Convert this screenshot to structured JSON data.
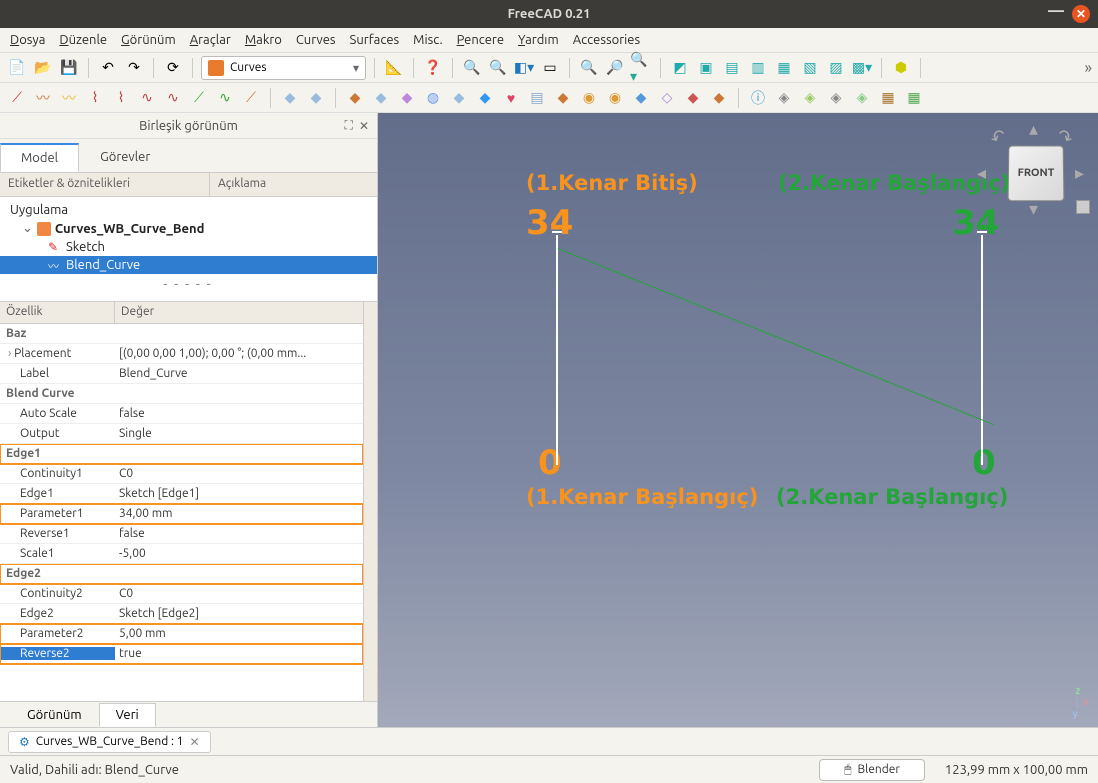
{
  "title": "FreeCAD 0.21",
  "menus": [
    "Dosya",
    "Düzenle",
    "Görünüm",
    "Araçlar",
    "Makro",
    "Curves",
    "Surfaces",
    "Misc.",
    "Pencere",
    "Yardım",
    "Accessories"
  ],
  "menu_underlines": [
    0,
    0,
    0,
    0,
    0,
    -1,
    -1,
    -1,
    0,
    0,
    -1
  ],
  "workbench": "Curves",
  "panel_title": "Birleşik görünüm",
  "tabs": {
    "model": "Model",
    "tasks": "Görevler"
  },
  "tree_headers": {
    "labels": "Etiketler & öznitelikleri",
    "desc": "Açıklama"
  },
  "tree": {
    "root": "Uygulama",
    "doc": "Curves_WB_Curve_Bend",
    "items": [
      "Sketch",
      "Blend_Curve"
    ],
    "selected": 1
  },
  "prop_headers": {
    "name": "Özellik",
    "value": "Değer"
  },
  "props": {
    "groups": [
      {
        "name": "Baz",
        "rows": [
          {
            "n": "Placement",
            "v": "[(0,00 0,00 1,00); 0,00 °; (0,00 mm...",
            "expand": true
          },
          {
            "n": "Label",
            "v": "Blend_Curve"
          }
        ]
      },
      {
        "name": "Blend Curve",
        "rows": [
          {
            "n": "Auto Scale",
            "v": "false"
          },
          {
            "n": "Output",
            "v": "Single"
          }
        ]
      },
      {
        "name": "Edge1",
        "hl": true,
        "rows": [
          {
            "n": "Continuity1",
            "v": "C0"
          },
          {
            "n": "Edge1",
            "v": "Sketch [Edge1]"
          },
          {
            "n": "Parameter1",
            "v": "34,00 mm",
            "hl": true
          },
          {
            "n": "Reverse1",
            "v": "false"
          },
          {
            "n": "Scale1",
            "v": "-5,00"
          }
        ]
      },
      {
        "name": "Edge2",
        "hl": true,
        "rows": [
          {
            "n": "Continuity2",
            "v": "C0"
          },
          {
            "n": "Edge2",
            "v": "Sketch [Edge2]"
          },
          {
            "n": "Parameter2",
            "v": "5,00 mm",
            "hl": true
          },
          {
            "n": "Reverse2",
            "v": "true",
            "hl": true,
            "sel": true
          }
        ]
      }
    ]
  },
  "bottom_tabs": {
    "view": "Görünüm",
    "data": "Veri"
  },
  "viewport": {
    "labels": {
      "e1_end": "(1.Kenar Bitiş)",
      "e1_end_val": "34",
      "e2_start_top": "(2.Kenar Başlangıç)",
      "e2_start_top_val": "34",
      "e1_start_val": "0",
      "e1_start": "(1.Kenar Başlangıç)",
      "e2_start_val": "0",
      "e2_start": "(2.Kenar Başlangıç)"
    },
    "cube_face": "FRONT"
  },
  "doc_tab": "Curves_WB_Curve_Bend : 1",
  "status": {
    "left": "Valid, Dahili adı: Blend_Curve",
    "nav": "Blender",
    "dims": "123,99 mm x 100,00 mm"
  }
}
